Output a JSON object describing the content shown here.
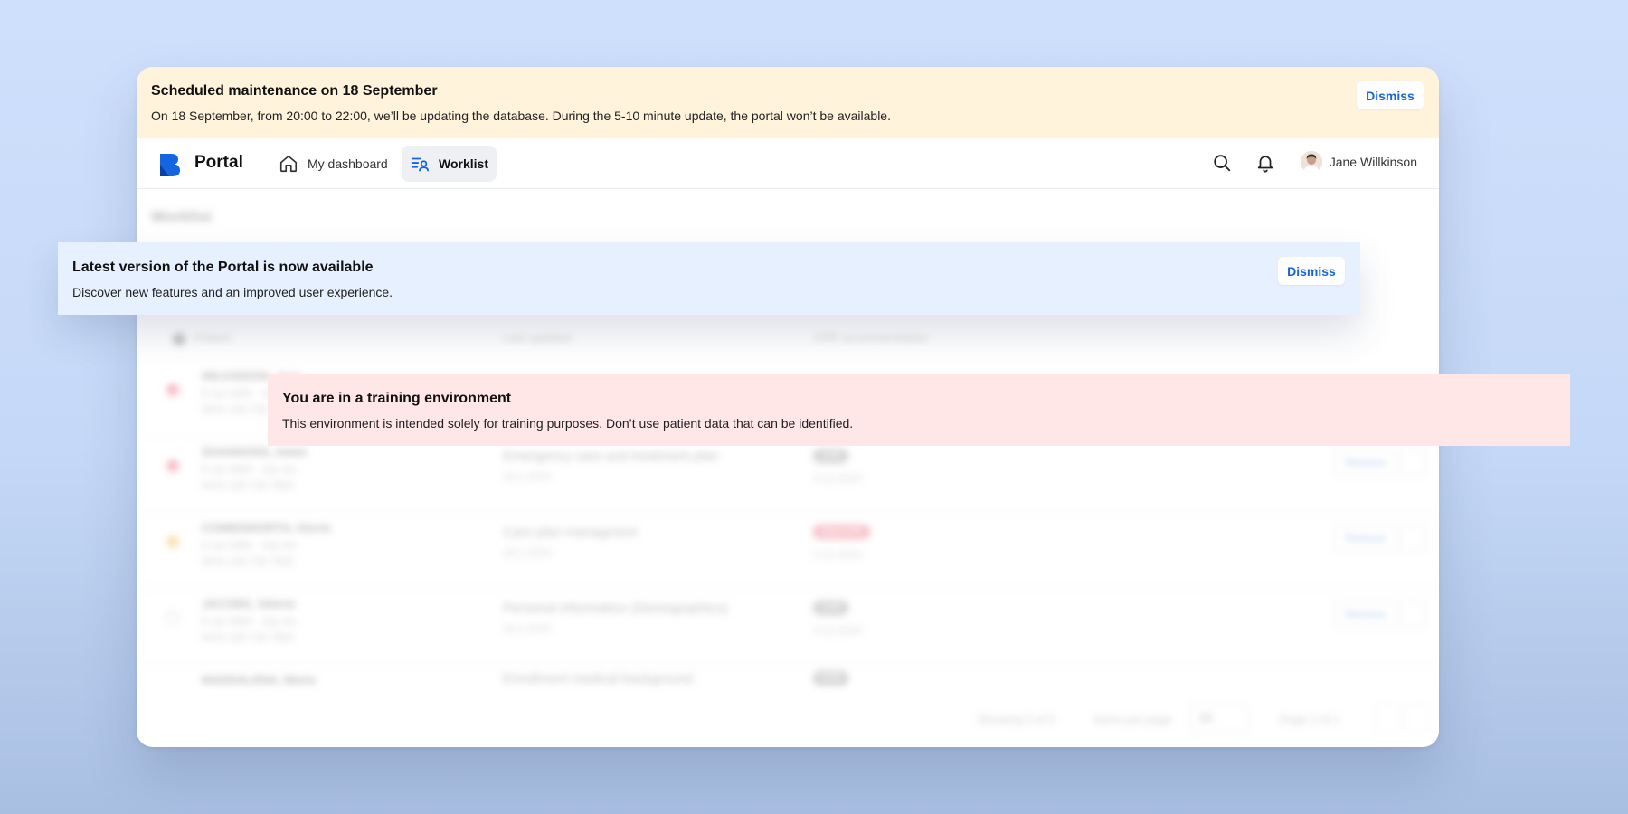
{
  "maintenance_banner": {
    "title": "Scheduled maintenance on 18 September",
    "text": "On 18 September, from 20:00 to 22:00, we’ll be updating the database. During the 5-10 minute update, the portal won’t be available.",
    "dismiss_label": "Dismiss",
    "background": "#fff3dc"
  },
  "nav": {
    "brand": "Portal",
    "brand_color": "#1565e0",
    "items": [
      {
        "label": "My dashboard",
        "icon": "home-icon",
        "active": false
      },
      {
        "label": "Worklist",
        "icon": "worklist-icon",
        "active": true
      }
    ],
    "search_icon": "search-icon",
    "notifications_icon": "bell-icon",
    "user_name": "Jane Willkinson"
  },
  "worklist": {
    "page_title": "Worklist",
    "columns": [
      "Patient",
      "Last updated",
      "CPR recommendation"
    ],
    "rows": [
      {
        "name": "WILKINSON, Jane",
        "dob": "8 Jul 1993 · 24y 4m",
        "nhs": "NHS 139 728 7652",
        "last_updated_title": "",
        "last_updated_date": "",
        "cpr": "",
        "cpr_date": "",
        "status_color": "#e53950",
        "remove": "Remove"
      },
      {
        "name": "SHANNONS, Adele",
        "dob": "8 Jul 1993 · 24y 4m",
        "nhs": "NHS 139 728 7652",
        "last_updated_title": "Emergency care and treatment plan",
        "last_updated_date": "18.1.2024",
        "cpr": "CPR",
        "cpr_date": "3.12.2023",
        "status_color": "#e53950",
        "remove": "Remove"
      },
      {
        "name": "COMBSWORTH, Gloria",
        "dob": "8 Jul 1993 · 24y 4m",
        "nhs": "NHS 139 728 7652",
        "last_updated_title": "Care plan managment",
        "last_updated_date": "18.1.2024",
        "cpr": "DNACPR",
        "cpr_date": "3.12.2024",
        "status_color": "#f2a516",
        "remove": "Remove"
      },
      {
        "name": "JACOBS, Valerie",
        "dob": "8 Jul 1993 · 24y 4m",
        "nhs": "NHS 139 728 7652",
        "last_updated_title": "Personal information (Demographics)",
        "last_updated_date": "18.1.2024",
        "cpr": "CPR",
        "cpr_date": "3.12.2024",
        "status_color": "#ffffff",
        "remove": "Remove"
      },
      {
        "name": "MADDALENA, Marta",
        "dob": "",
        "nhs": "",
        "last_updated_title": "Enrollment medical background",
        "last_updated_date": "",
        "cpr": "CPR",
        "cpr_date": "",
        "status_color": "#ffffff",
        "remove": ""
      }
    ],
    "footer": {
      "showing": "Showing 5 of 5",
      "items_per_page_label": "Items per page",
      "items_per_page_value": "20",
      "page": "Page 1 of 1"
    }
  },
  "portal_banner": {
    "title": "Latest version of the Portal is now available",
    "text": "Discover new features and an improved user experience.",
    "dismiss_label": "Dismiss",
    "background": "#e6f0fe"
  },
  "training_banner": {
    "title": "You are in a training environment",
    "text": "This environment is intended solely for training purposes. Don’t use patient data that can be identified.",
    "background": "#ffe7e7"
  }
}
